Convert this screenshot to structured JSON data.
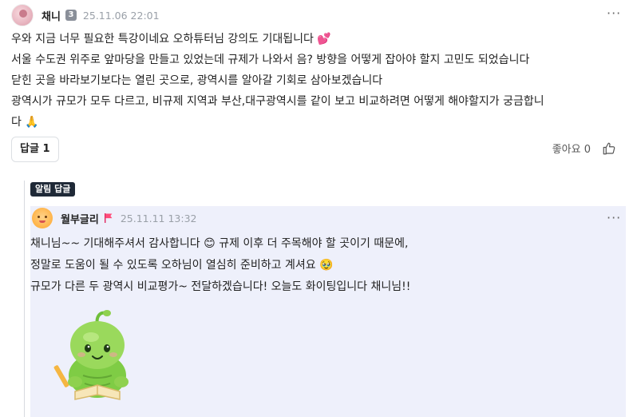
{
  "comment": {
    "author": "채니",
    "level": "3",
    "date": "25.11.06 22:01",
    "more": "···",
    "lines": [
      "우와  지금 너무 필요한 특강이네요 오하튜터님 강의도 기대됩니다 ",
      "서울 수도권 위주로 앞마당을 만들고 있었는데 규제가 나와서 음? 방향을 어떻게 잡아야 할지 고민도 되었습니다",
      "닫힌 곳을 바라보기보다는 열린 곳으로,  광역시를 알아갈 기회로 삼아보겠습니다",
      "광역시가 규모가 모두 다르고, 비규제 지역과 부산,대구광역시를 같이 보고 비교하려면 어떻게 해야할지가 궁금합니",
      "다 "
    ],
    "emoji_heart": "💕",
    "emoji_pray": "🙏",
    "reply_button": "답글 1",
    "like_label": "좋아요 0",
    "icons": {
      "like": "thumbs-up-icon",
      "more": "more-horizontal-icon"
    }
  },
  "reply": {
    "badge": "알림 답글",
    "author": "월부글리",
    "date": "25.11.11 13:32",
    "more": "···",
    "lines": [
      "채니님~~ 기대해주셔서 감사합니다 ",
      "정말로 도움이 될 수 있도록 오하님이 열심히 준비하고 계셔요 ",
      "규모가 다른 두 광역시 비교평가~ 전달하겠습니다! 오늘도 화이팅입니다 채니님!!"
    ],
    "line1_tail": " 규제 이후 더 주목해야 할 곳이기 때문에,",
    "emoji_smile": "😊",
    "emoji_plead": "🥹",
    "sticker": "green-character-reading-sticker",
    "colors": {
      "box_bg": "#eef0fb",
      "badge_bg": "#1f2937"
    }
  }
}
